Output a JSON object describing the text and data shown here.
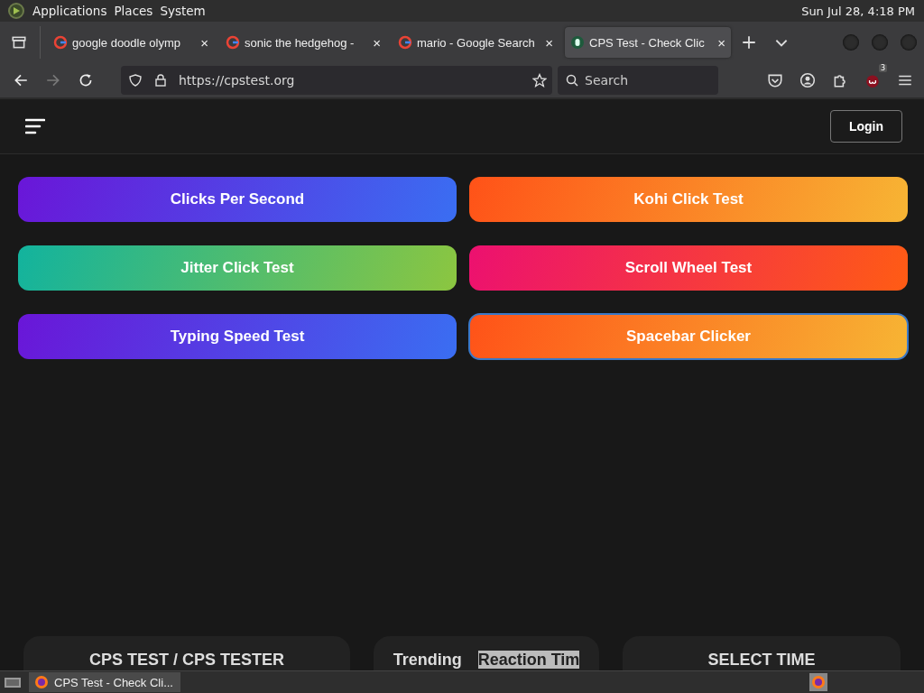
{
  "top_panel": {
    "menus": [
      "Applications",
      "Places",
      "System"
    ],
    "clock": "Sun Jul 28,  4:18 PM"
  },
  "tabs": [
    {
      "label": "google doodle olymp",
      "close": "×",
      "selected": false,
      "kind": "google"
    },
    {
      "label": "sonic the hedgehog -",
      "close": "×",
      "selected": false,
      "kind": "google"
    },
    {
      "label": "mario - Google Search",
      "close": "×",
      "selected": false,
      "kind": "google"
    },
    {
      "label": "CPS Test - Check Clic",
      "close": "×",
      "selected": true,
      "kind": "site"
    }
  ],
  "address_bar": {
    "url": "https://cpstest.org",
    "search_placeholder": "Search",
    "extension_badge": "3"
  },
  "page": {
    "login": "Login",
    "buttons": [
      {
        "label": "Clicks Per Second",
        "kind": "violet",
        "focused": false
      },
      {
        "label": "Kohi Click Test",
        "kind": "orange",
        "focused": false
      },
      {
        "label": "Jitter Click Test",
        "kind": "teal",
        "focused": false
      },
      {
        "label": "Scroll Wheel Test",
        "kind": "pink",
        "focused": false
      },
      {
        "label": "Typing Speed Test",
        "kind": "violet",
        "focused": false
      },
      {
        "label": "Spacebar Clicker",
        "kind": "orange",
        "focused": true
      }
    ],
    "cards": [
      {
        "title": "CPS TEST / CPS TESTER"
      },
      {
        "title": "Trending",
        "highlight": "Reaction Tim"
      },
      {
        "title": "SELECT TIME"
      }
    ]
  },
  "taskbar": {
    "window": "CPS Test - Check Cli..."
  }
}
